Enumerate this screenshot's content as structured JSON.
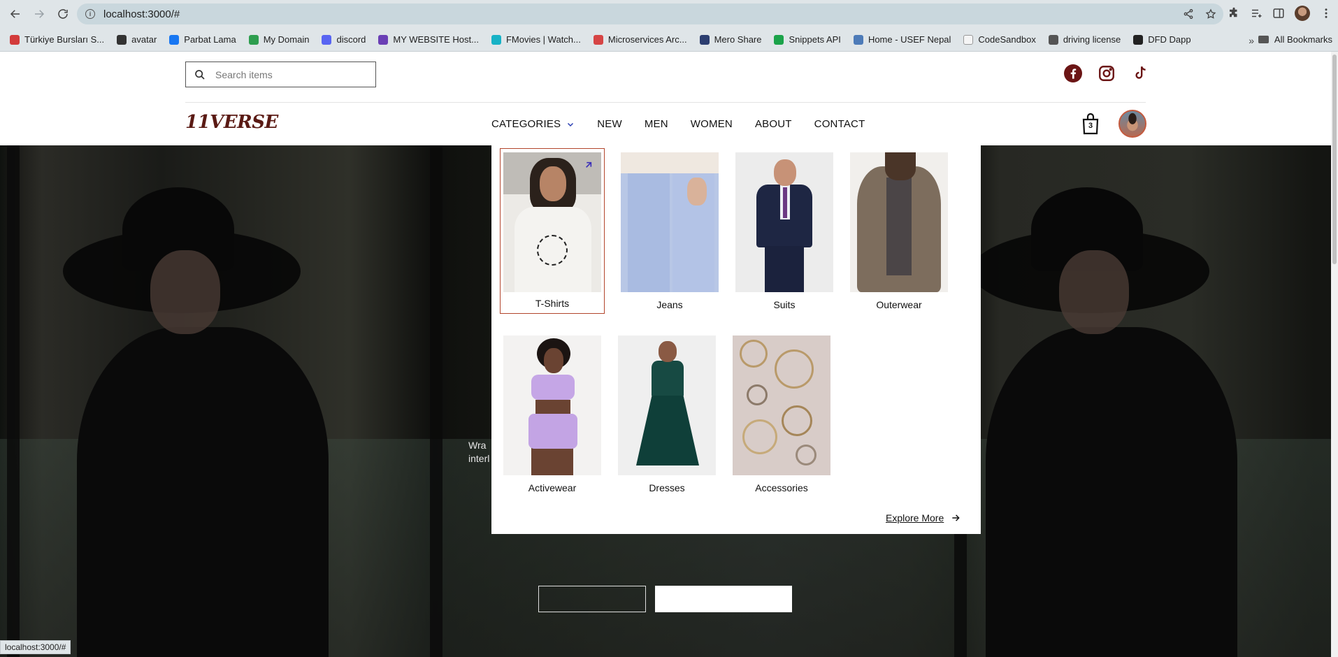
{
  "browser": {
    "url": "localhost:3000/#",
    "status_url": "localhost:3000/#",
    "bookmarks": [
      {
        "label": "Türkiye Bursları S...",
        "color": "#d33b3b"
      },
      {
        "label": "avatar",
        "color": "#333333"
      },
      {
        "label": "Parbat Lama",
        "color": "#1877f2"
      },
      {
        "label": "My Domain",
        "color": "#2e9e4f"
      },
      {
        "label": "discord",
        "color": "#5865f2"
      },
      {
        "label": "MY WEBSITE Host...",
        "color": "#6a3fb5"
      },
      {
        "label": "FMovies | Watch...",
        "color": "#17b2c6"
      },
      {
        "label": "Microservices Arc...",
        "color": "#d64545"
      },
      {
        "label": "Mero Share",
        "color": "#2c3e70"
      },
      {
        "label": "Snippets API",
        "color": "#1ba34a"
      },
      {
        "label": "Home - USEF Nepal",
        "color": "#4d7bb8"
      },
      {
        "label": "CodeSandbox",
        "color": "#f5f5f5"
      },
      {
        "label": "driving license",
        "color": "#555555"
      },
      {
        "label": "DFD Dapp",
        "color": "#222222"
      }
    ],
    "bookmarks_more": "»",
    "all_bookmarks": "All Bookmarks"
  },
  "site": {
    "search_placeholder": "Search items",
    "logo": "11VERSE",
    "menu": {
      "categories": "CATEGORIES",
      "new": "NEW",
      "men": "MEN",
      "women": "WOMEN",
      "about": "ABOUT",
      "contact": "CONTACT"
    },
    "cart_count": "3",
    "hero_text": "Wra\ninter",
    "brand_color": "#5a1a14",
    "active_border_color": "#b2452c"
  },
  "dropdown": {
    "categories": [
      {
        "label": "T-Shirts"
      },
      {
        "label": "Jeans"
      },
      {
        "label": "Suits"
      },
      {
        "label": "Outerwear"
      },
      {
        "label": "Activewear"
      },
      {
        "label": "Dresses"
      },
      {
        "label": "Accessories"
      }
    ],
    "explore_label": "Explore More"
  }
}
